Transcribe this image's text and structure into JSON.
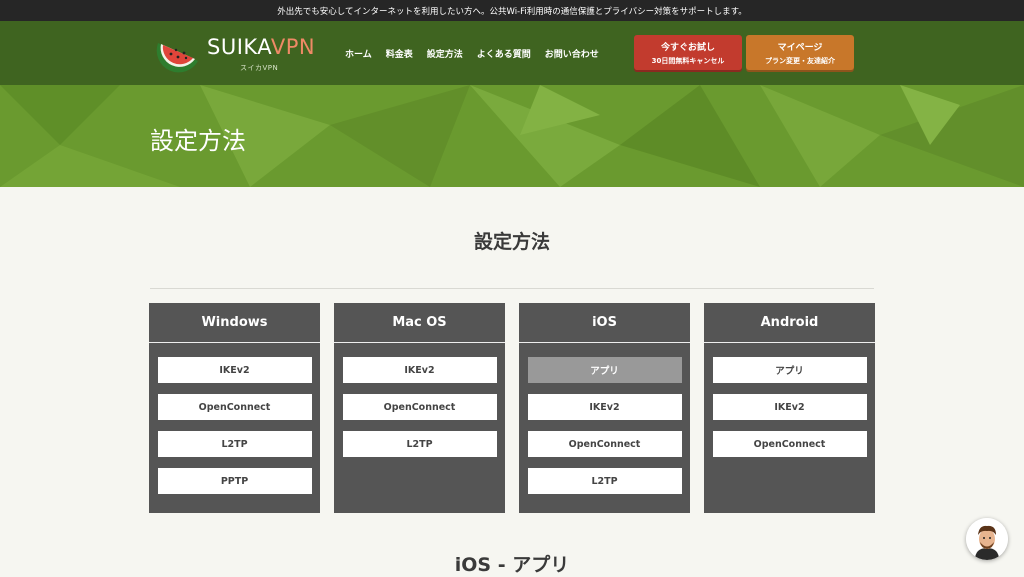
{
  "topbar": {
    "text": "外出先でも安心してインターネットを利用したい方へ。公共Wi-Fi利用時の通信保護とプライバシー対策をサポートします。"
  },
  "logo": {
    "brand1": "SUIKA",
    "brand2": "VPN",
    "sub": "スイカVPN",
    "icon": "watermelon-icon"
  },
  "nav": {
    "items": [
      "ホーム",
      "料金表",
      "設定方法",
      "よくある質問",
      "お問い合わせ"
    ]
  },
  "cta": {
    "trial_line1": "今すぐお試し",
    "trial_line2": "30日間無料キャンセル",
    "mypage_line1": "マイページ",
    "mypage_line2": "プラン変更・友達紹介"
  },
  "hero": {
    "title": "設定方法"
  },
  "section": {
    "title": "設定方法"
  },
  "platforms": [
    {
      "name": "Windows",
      "items": [
        "IKEv2",
        "OpenConnect",
        "L2TP",
        "PPTP"
      ]
    },
    {
      "name": "Mac OS",
      "items": [
        "IKEv2",
        "OpenConnect",
        "L2TP"
      ]
    },
    {
      "name": "iOS",
      "items": [
        "アプリ",
        "IKEv2",
        "OpenConnect",
        "L2TP"
      ],
      "active_index": 0
    },
    {
      "name": "Android",
      "items": [
        "アプリ",
        "IKEv2",
        "OpenConnect"
      ]
    }
  ],
  "subsection": {
    "title": "iOS - アプリ"
  },
  "colors": {
    "header": "#3f6420",
    "hero": "#6a9a2f",
    "card": "#555555",
    "trial": "#c23b2e",
    "mypage": "#c8772a"
  },
  "chat": {
    "icon": "support-avatar-icon"
  }
}
